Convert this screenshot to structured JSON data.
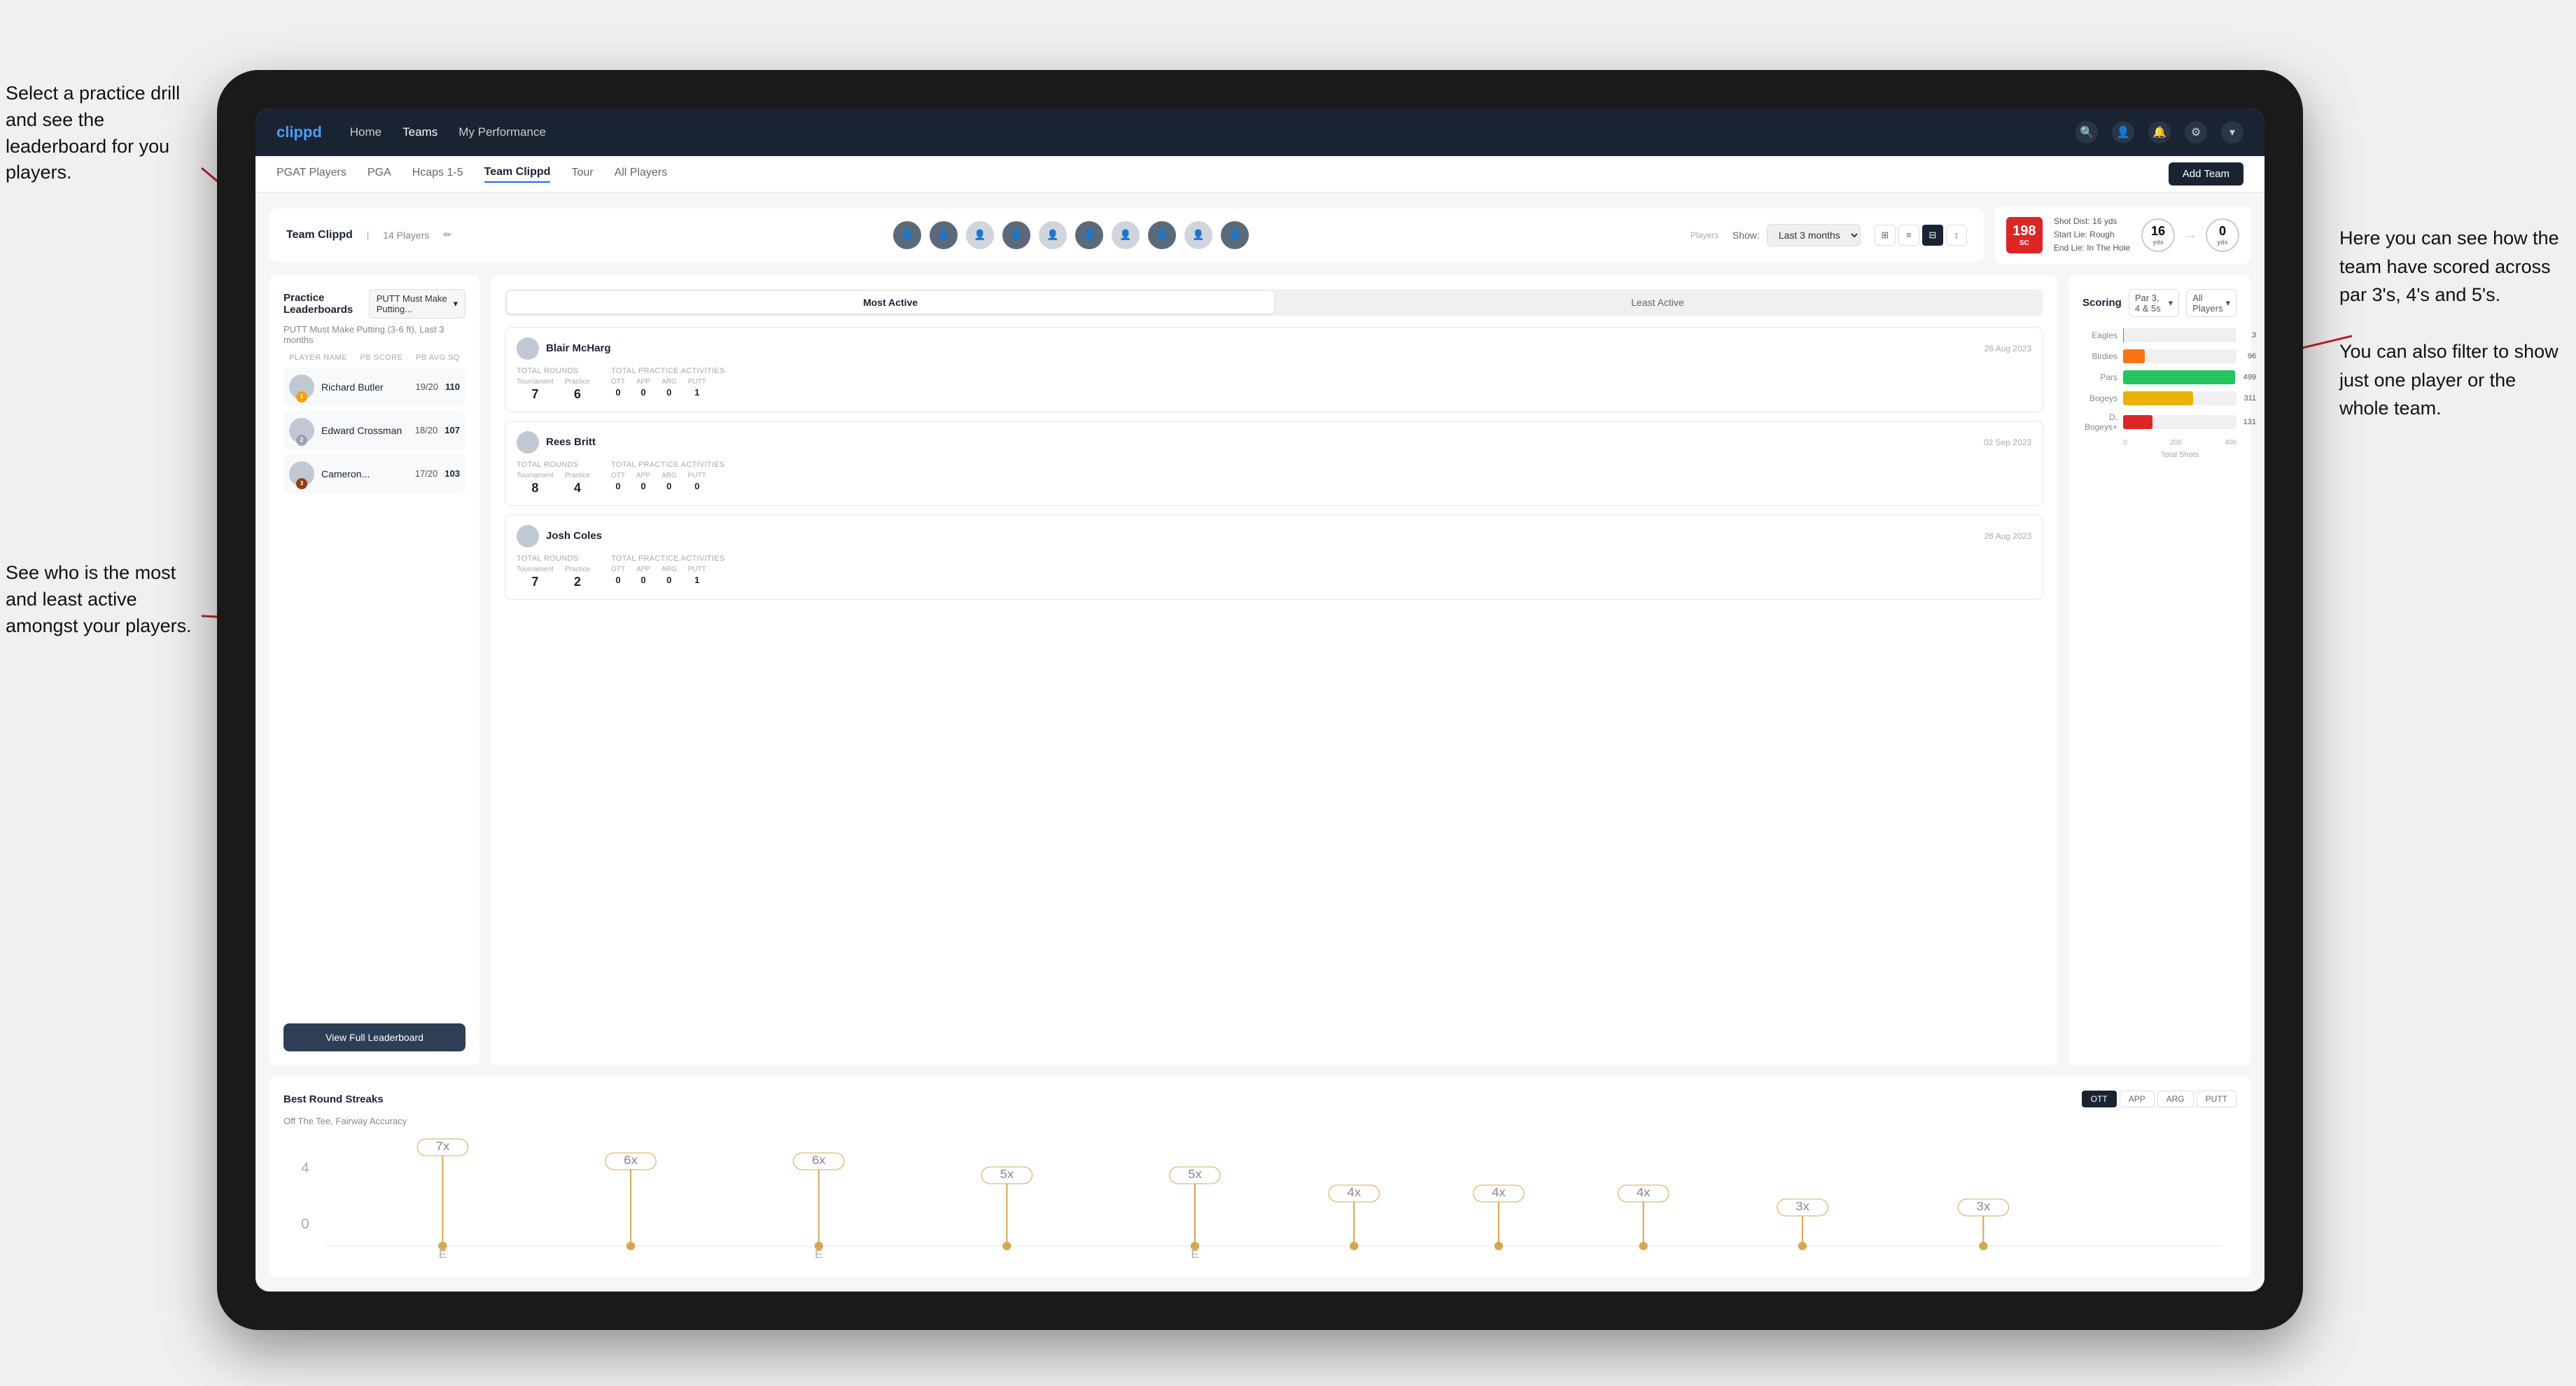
{
  "annotations": {
    "top_left": "Select a practice drill and see the leaderboard for you players.",
    "bottom_left": "See who is the most and least active amongst your players.",
    "right": "Here you can see how the team have scored across par 3's, 4's and 5's.\n\nYou can also filter to show just one player or the whole team."
  },
  "nav": {
    "logo": "clippd",
    "links": [
      "Home",
      "Teams",
      "My Performance"
    ],
    "active": "Teams"
  },
  "sub_nav": {
    "links": [
      "PGAT Players",
      "PGA",
      "Hcaps 1-5",
      "Team Clippd",
      "Tour",
      "All Players"
    ],
    "active": "Team Clippd",
    "add_btn": "Add Team"
  },
  "team_header": {
    "title": "Team Clippd",
    "count": "14 Players",
    "show_label": "Show:",
    "show_value": "Last 3 months",
    "players_label": "Players"
  },
  "shot_info": {
    "badge": "198",
    "badge_sub": "SC",
    "shot_dist_label": "Shot Dist: 16 yds",
    "start_lie": "Start Lie: Rough",
    "end_lie": "End Lie: In The Hole",
    "circle1_val": "16",
    "circle1_label": "yds",
    "circle2_val": "0",
    "circle2_label": "yds"
  },
  "practice_leaderboard": {
    "title": "Practice Leaderboards",
    "drill": "PUTT Must Make Putting...",
    "subtitle": "PUTT Must Make Putting (3-6 ft), Last 3 months",
    "col_player": "PLAYER NAME",
    "col_score": "PB SCORE",
    "col_avg": "PB AVG SQ",
    "players": [
      {
        "name": "Richard Butler",
        "score": "19/20",
        "avg": "110",
        "rank": "1",
        "badge": "gold"
      },
      {
        "name": "Edward Crossman",
        "score": "18/20",
        "avg": "107",
        "rank": "2",
        "badge": "silver"
      },
      {
        "name": "Cameron...",
        "score": "17/20",
        "avg": "103",
        "rank": "3",
        "badge": "bronze"
      }
    ],
    "view_btn": "View Full Leaderboard"
  },
  "activity": {
    "tabs": [
      "Most Active",
      "Least Active"
    ],
    "active_tab": "Most Active",
    "players": [
      {
        "name": "Blair McHarg",
        "date": "26 Aug 2023",
        "total_rounds_label": "Total Rounds",
        "tournament": "7",
        "practice": "6",
        "total_practice_label": "Total Practice Activities",
        "ott": "0",
        "app": "0",
        "arg": "0",
        "putt": "1"
      },
      {
        "name": "Rees Britt",
        "date": "02 Sep 2023",
        "total_rounds_label": "Total Rounds",
        "tournament": "8",
        "practice": "4",
        "total_practice_label": "Total Practice Activities",
        "ott": "0",
        "app": "0",
        "arg": "0",
        "putt": "0"
      },
      {
        "name": "Josh Coles",
        "date": "26 Aug 2023",
        "total_rounds_label": "Total Rounds",
        "tournament": "7",
        "practice": "2",
        "total_practice_label": "Total Practice Activities",
        "ott": "0",
        "app": "0",
        "arg": "0",
        "putt": "1"
      }
    ]
  },
  "scoring": {
    "title": "Scoring",
    "filter1": "Par 3, 4 & 5s",
    "filter2": "All Players",
    "bars": [
      {
        "label": "Eagles",
        "val": 3,
        "max": 500,
        "color": "red",
        "display": "3"
      },
      {
        "label": "Birdies",
        "val": 96,
        "max": 500,
        "color": "orange",
        "display": "96"
      },
      {
        "label": "Pars",
        "val": 499,
        "max": 500,
        "color": "green",
        "display": "499"
      },
      {
        "label": "Bogeys",
        "val": 311,
        "max": 500,
        "color": "yellow",
        "display": "311"
      },
      {
        "label": "D. Bogeys+",
        "val": 131,
        "max": 500,
        "color": "red2",
        "display": "131"
      }
    ],
    "axis": [
      "0",
      "200",
      "400"
    ],
    "x_label": "Total Shots"
  },
  "streaks": {
    "title": "Best Round Streaks",
    "subtitle": "Off The Tee, Fairway Accuracy",
    "btns": [
      "OTT",
      "APP",
      "ARG",
      "PUTT"
    ],
    "active_btn": "OTT",
    "data": [
      {
        "label": "E",
        "badge": "7x",
        "height": 130
      },
      {
        "label": "",
        "badge": "6x",
        "height": 105
      },
      {
        "label": "E",
        "badge": "6x",
        "height": 105
      },
      {
        "label": "",
        "badge": "5x",
        "height": 85
      },
      {
        "label": "E",
        "badge": "5x",
        "height": 85
      },
      {
        "label": "",
        "badge": "4x",
        "height": 65
      },
      {
        "label": "",
        "badge": "4x",
        "height": 65
      },
      {
        "label": "",
        "badge": "4x",
        "height": 65
      },
      {
        "label": "",
        "badge": "3x",
        "height": 45
      },
      {
        "label": "",
        "badge": "3x",
        "height": 45
      }
    ]
  }
}
